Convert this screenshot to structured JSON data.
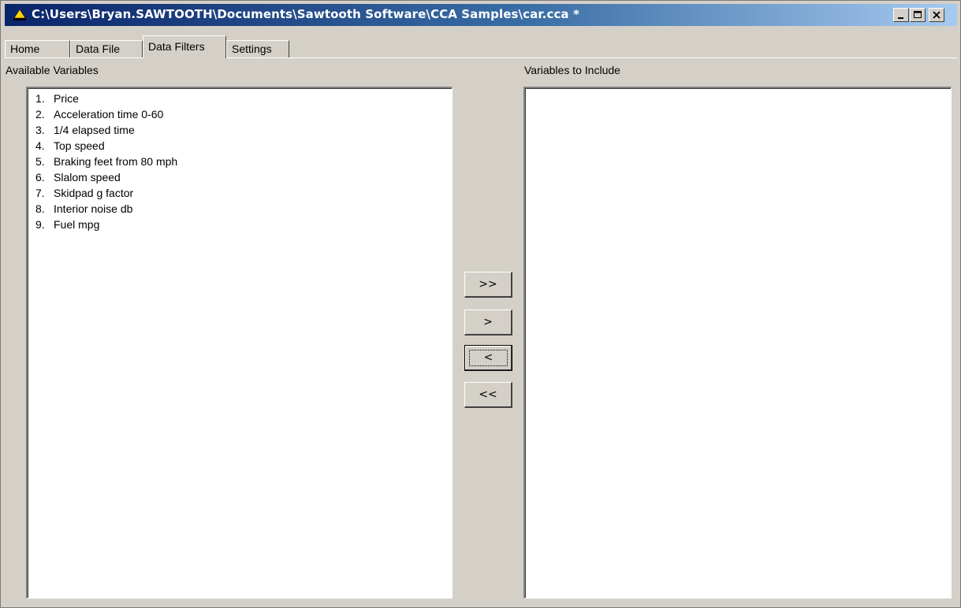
{
  "window": {
    "title": "C:\\Users\\Bryan.SAWTOOTH\\Documents\\Sawtooth Software\\CCA Samples\\car.cca *",
    "controls": {
      "minimize_label": "_",
      "maximize_label": "□",
      "close_label": "×"
    }
  },
  "tabs": [
    {
      "label": "Home"
    },
    {
      "label": "Data File"
    },
    {
      "label": "Data Filters",
      "active": true
    },
    {
      "label": "Settings"
    }
  ],
  "available": {
    "label": "Available Variables",
    "items": [
      {
        "num": "1.",
        "text": "Price"
      },
      {
        "num": "2.",
        "text": "Acceleration time 0-60"
      },
      {
        "num": "3.",
        "text": "1/4 elapsed time"
      },
      {
        "num": "4.",
        "text": "Top speed"
      },
      {
        "num": "5.",
        "text": "Braking feet from 80 mph"
      },
      {
        "num": "6.",
        "text": "Slalom speed"
      },
      {
        "num": "7.",
        "text": "Skidpad g factor"
      },
      {
        "num": "8.",
        "text": "Interior noise db"
      },
      {
        "num": "9.",
        "text": "Fuel mpg"
      }
    ]
  },
  "include": {
    "label": "Variables to Include",
    "items": []
  },
  "buttons": {
    "add_all": ">>",
    "add": ">",
    "remove": "<",
    "remove_all": "<<"
  },
  "colors": {
    "titlebar_start": "#0a246a",
    "titlebar_end": "#a6caf0",
    "face": "#d4d0c8"
  },
  "icons": {
    "app": "sawtooth-app-icon"
  }
}
